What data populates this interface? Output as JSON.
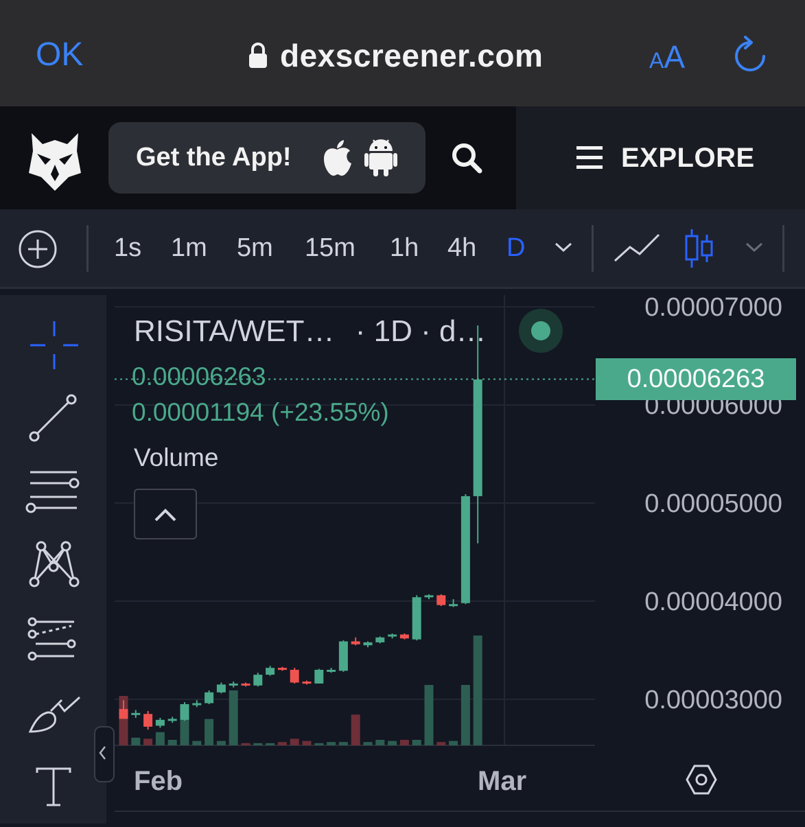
{
  "browser": {
    "ok_label": "OK",
    "url": "dexscreener.com",
    "text_size_small": "A",
    "text_size_large": "A"
  },
  "header": {
    "app_button_label": "Get the App!",
    "explore_label": "EXPLORE"
  },
  "toolbar": {
    "timeframes": [
      "1s",
      "1m",
      "5m",
      "15m",
      "1h",
      "4h",
      "D"
    ],
    "active_timeframe": "D"
  },
  "legend": {
    "title": "RISITA/WET…",
    "interval": "· 1D · d…",
    "price": "0.00006263",
    "change": "0.00001194 (+23.55%)",
    "volume_label": "Volume"
  },
  "colors": {
    "up": "#4aa98a",
    "down": "#ef5350",
    "accent": "#2962ff"
  },
  "chart_data": {
    "type": "candlestick",
    "pair": "RISITA/WET…",
    "interval": "1D",
    "last_price": "0.00006263",
    "x_tick_labels": [
      "Feb",
      "Mar"
    ],
    "y_tick_labels": [
      "0.00007000",
      "0.00006000",
      "0.00005000",
      "0.00004000",
      "0.00003000"
    ],
    "y_ticks": [
      7e-05,
      6e-05,
      5e-05,
      4e-05,
      3e-05
    ],
    "ylim": [
      2.53e-05,
      7.12e-05
    ],
    "grid": true,
    "candles": [
      {
        "o": 2.9e-05,
        "h": 2.99e-05,
        "l": 2.81e-05,
        "c": 2.8e-05
      },
      {
        "o": 2.84e-05,
        "h": 2.89e-05,
        "l": 2.81e-05,
        "c": 2.86e-05
      },
      {
        "o": 2.85e-05,
        "h": 2.88e-05,
        "l": 2.69e-05,
        "c": 2.72e-05
      },
      {
        "o": 2.73e-05,
        "h": 2.81e-05,
        "l": 2.71e-05,
        "c": 2.79e-05
      },
      {
        "o": 2.78e-05,
        "h": 2.82e-05,
        "l": 2.76e-05,
        "c": 2.8e-05
      },
      {
        "o": 2.79e-05,
        "h": 2.97e-05,
        "l": 2.78e-05,
        "c": 2.95e-05
      },
      {
        "o": 2.94e-05,
        "h": 2.99e-05,
        "l": 2.92e-05,
        "c": 2.96e-05
      },
      {
        "o": 2.96e-05,
        "h": 3.09e-05,
        "l": 2.95e-05,
        "c": 3.07e-05
      },
      {
        "o": 3.07e-05,
        "h": 3.17e-05,
        "l": 3.06e-05,
        "c": 3.15e-05
      },
      {
        "o": 3.14e-05,
        "h": 3.18e-05,
        "l": 3.12e-05,
        "c": 3.16e-05
      },
      {
        "o": 3.16e-05,
        "h": 3.17e-05,
        "l": 3.13e-05,
        "c": 3.15e-05
      },
      {
        "o": 3.14e-05,
        "h": 3.27e-05,
        "l": 3.13e-05,
        "c": 3.25e-05
      },
      {
        "o": 3.25e-05,
        "h": 3.34e-05,
        "l": 3.24e-05,
        "c": 3.32e-05
      },
      {
        "o": 3.32e-05,
        "h": 3.33e-05,
        "l": 3.29e-05,
        "c": 3.3e-05
      },
      {
        "o": 3.3e-05,
        "h": 3.32e-05,
        "l": 3.16e-05,
        "c": 3.17e-05
      },
      {
        "o": 3.18e-05,
        "h": 3.19e-05,
        "l": 3.15e-05,
        "c": 3.17e-05
      },
      {
        "o": 3.16e-05,
        "h": 3.31e-05,
        "l": 3.16e-05,
        "c": 3.3e-05
      },
      {
        "o": 3.29e-05,
        "h": 3.32e-05,
        "l": 3.27e-05,
        "c": 3.3e-05
      },
      {
        "o": 3.29e-05,
        "h": 3.6e-05,
        "l": 3.28e-05,
        "c": 3.59e-05
      },
      {
        "o": 3.59e-05,
        "h": 3.63e-05,
        "l": 3.55e-05,
        "c": 3.56e-05
      },
      {
        "o": 3.55e-05,
        "h": 3.59e-05,
        "l": 3.53e-05,
        "c": 3.58e-05
      },
      {
        "o": 3.58e-05,
        "h": 3.64e-05,
        "l": 3.57e-05,
        "c": 3.63e-05
      },
      {
        "o": 3.64e-05,
        "h": 3.67e-05,
        "l": 3.62e-05,
        "c": 3.66e-05
      },
      {
        "o": 3.66e-05,
        "h": 3.67e-05,
        "l": 3.61e-05,
        "c": 3.62e-05
      },
      {
        "o": 3.61e-05,
        "h": 4.06e-05,
        "l": 3.6e-05,
        "c": 4.04e-05
      },
      {
        "o": 4.04e-05,
        "h": 4.07e-05,
        "l": 4.02e-05,
        "c": 4.06e-05
      },
      {
        "o": 4.06e-05,
        "h": 4.07e-05,
        "l": 3.95e-05,
        "c": 3.96e-05
      },
      {
        "o": 3.96e-05,
        "h": 4.02e-05,
        "l": 3.94e-05,
        "c": 3.97e-05
      },
      {
        "o": 3.98e-05,
        "h": 5.09e-05,
        "l": 3.97e-05,
        "c": 5.07e-05
      },
      {
        "o": 5.07e-05,
        "h": 6.81e-05,
        "l": 4.59e-05,
        "c": 6.26e-05
      }
    ],
    "volume_rel": [
      0.45,
      0.07,
      0.06,
      0.12,
      0.05,
      0.3,
      0.04,
      0.24,
      0.04,
      0.5,
      0.02,
      0.02,
      0.02,
      0.03,
      0.06,
      0.04,
      0.02,
      0.03,
      0.03,
      0.28,
      0.03,
      0.05,
      0.04,
      0.05,
      0.05,
      0.55,
      0.03,
      0.04,
      0.55,
      1.0
    ]
  }
}
